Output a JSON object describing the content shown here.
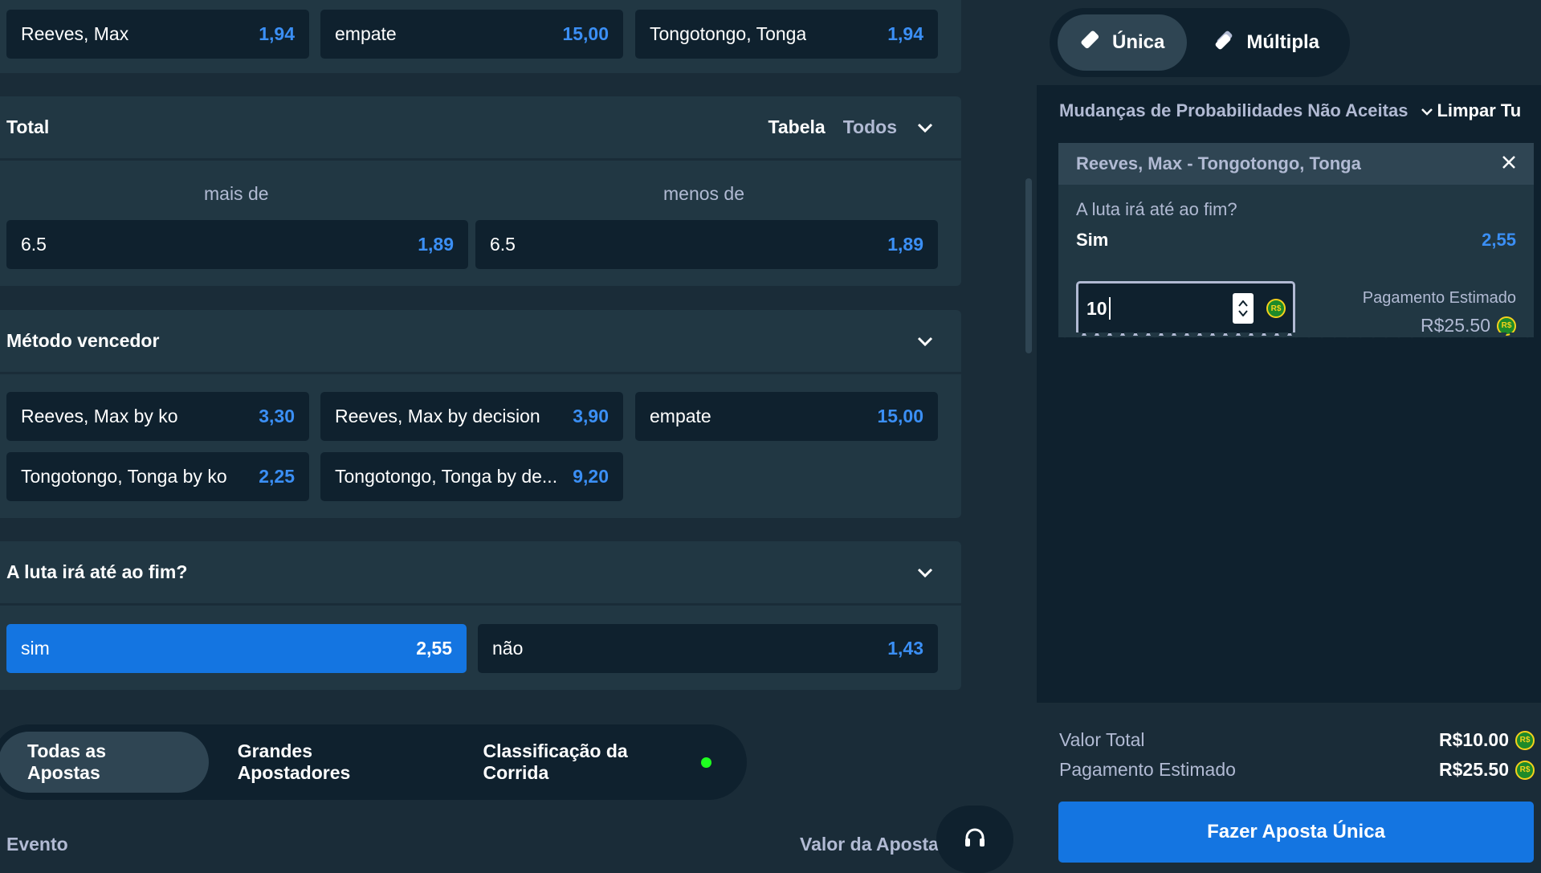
{
  "top_row": [
    {
      "label": "Reeves, Max",
      "odds": "1,94"
    },
    {
      "label": "empate",
      "odds": "15,00"
    },
    {
      "label": "Tongotongo, Tonga",
      "odds": "1,94"
    }
  ],
  "total": {
    "title": "Total",
    "view_table": "Tabela",
    "view_all": "Todos",
    "over_label": "mais de",
    "under_label": "menos de",
    "over": {
      "line": "6.5",
      "odds": "1,89"
    },
    "under": {
      "line": "6.5",
      "odds": "1,89"
    }
  },
  "method": {
    "title": "Método vencedor",
    "options": [
      {
        "label": "Reeves, Max by ko",
        "odds": "3,30"
      },
      {
        "label": "Reeves, Max by decision",
        "odds": "3,90"
      },
      {
        "label": "empate",
        "odds": "15,00"
      },
      {
        "label": "Tongotongo, Tonga by ko",
        "odds": "2,25"
      },
      {
        "label": "Tongotongo, Tonga by de...",
        "odds": "9,20"
      }
    ]
  },
  "distance": {
    "title": "A luta irá até ao fim?",
    "options": [
      {
        "label": "sim",
        "odds": "2,55",
        "selected": true
      },
      {
        "label": "não",
        "odds": "1,43",
        "selected": false
      }
    ]
  },
  "bottom_tabs": [
    "Todas as Apostas",
    "Grandes Apostadores",
    "Classificação da Corrida"
  ],
  "table_headers": {
    "event": "Evento",
    "bet_value": "Valor da Aposta"
  },
  "slip": {
    "tabs": [
      {
        "label": "Única",
        "icon": "ticket-icon",
        "active": true
      },
      {
        "label": "Múltipla",
        "icon": "tickets-icon",
        "active": false
      }
    ],
    "odds_change_setting": "Mudanças de Probabilidades Não Aceitas",
    "clear_all": "Limpar Tu",
    "bet": {
      "event": "Reeves, Max - Tongotongo, Tonga",
      "market": "A luta irá até ao fim?",
      "selection": "Sim",
      "odds": "2,55",
      "stake": "10",
      "currency_badge": "R$",
      "payout_label": "Pagamento Estimado",
      "payout_value": "R$25.50"
    },
    "summary": {
      "total_label": "Valor Total",
      "total_value": "R$10.00",
      "payout_label": "Pagamento Estimado",
      "payout_value": "R$25.50"
    },
    "place_button": "Fazer Aposta Única"
  },
  "colors": {
    "background": "#1a2c38",
    "card": "#213743",
    "odd_button": "#0f212e",
    "odds_text": "#3b8ff5",
    "selected": "#1475e1",
    "live_dot": "#1fff20"
  }
}
